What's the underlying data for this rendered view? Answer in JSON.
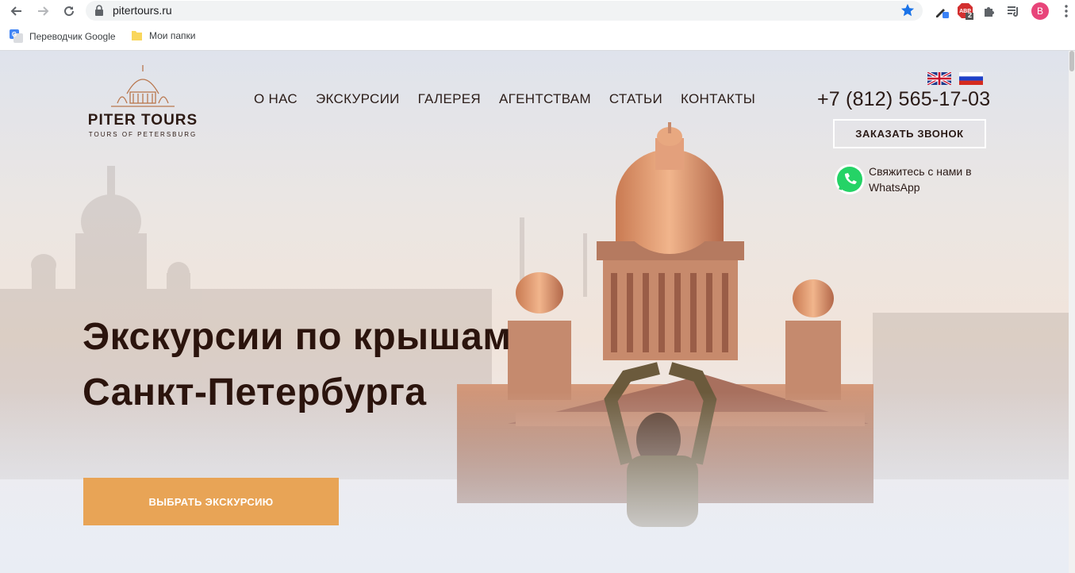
{
  "browser": {
    "url": "pitertours.ru",
    "extension_badge": "2",
    "profile_initial": "B",
    "bookmarks": [
      {
        "label": "Переводчик Google",
        "icon": "google-translate-icon"
      },
      {
        "label": "Мои папки",
        "icon": "folder-icon"
      }
    ]
  },
  "site": {
    "logo": {
      "brand": "PITER TOURS",
      "tagline": "TOURS OF PETERSBURG"
    },
    "nav": [
      "О НАС",
      "ЭКСКУРСИИ",
      "ГАЛЕРЕЯ",
      "АГЕНТСТВАМ",
      "СТАТЬИ",
      "КОНТАКТЫ"
    ],
    "languages": [
      "en",
      "ru"
    ],
    "phone": "+7 (812) 565-17-03",
    "callback_label": "ЗАКАЗАТЬ ЗВОНОК",
    "whatsapp_text": "Свяжитесь с нами в WhatsApp",
    "hero": {
      "title_line1": "Экскурсии по крышам",
      "title_line2": "Санкт-Петербурга",
      "cta_label": "ВЫБРАТЬ ЭКСКУРСИЮ"
    }
  },
  "colors": {
    "accent": "#e8a456",
    "text_dark": "#2b140d",
    "whatsapp": "#25d366"
  }
}
